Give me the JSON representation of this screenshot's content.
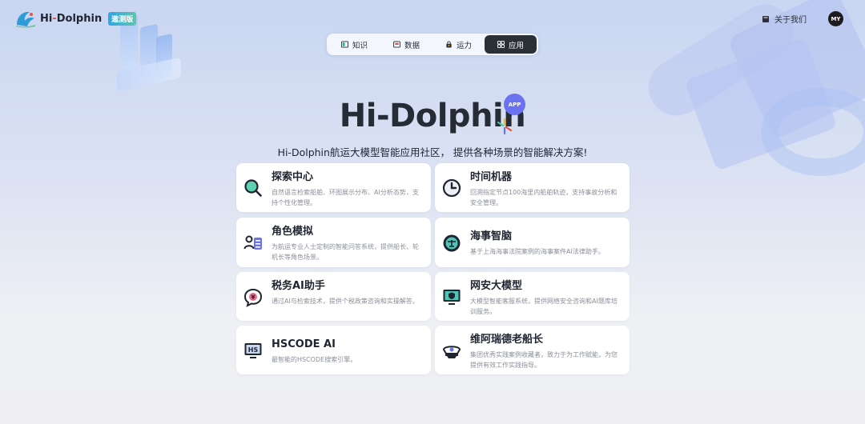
{
  "header": {
    "logo_prefix": "Hi",
    "logo_dash": "-",
    "logo_suffix": "Dolphin",
    "badge": "遨测版",
    "about_label": "关于我们",
    "avatar_initials": "MY"
  },
  "tabs": [
    {
      "label": "知识",
      "icon": "book-icon",
      "active": false
    },
    {
      "label": "数据",
      "icon": "database-icon",
      "active": false
    },
    {
      "label": "运力",
      "icon": "lock-icon",
      "active": false
    },
    {
      "label": "应用",
      "icon": "grid-icon",
      "active": true
    }
  ],
  "hero": {
    "title": "Hi-Dolphin",
    "app_badge": "APP",
    "subtitle": "Hi-Dolphin航运大模型智能应用社区， 提供各种场景的智能解决方案!"
  },
  "cards": [
    {
      "title": "探索中心",
      "desc": "自然语言检索船舶、环图展示分布、AI分析态势，支持个性化管理。",
      "icon": "search-icon"
    },
    {
      "title": "时间机器",
      "desc": "回溯指定节点100海里内船舶轨迹，支持事故分析和安全管理。",
      "icon": "clock-icon"
    },
    {
      "title": "角色模拟",
      "desc": "为航运专业人士定制的智能问答系统，提供船长、轮机长等角色场景。",
      "icon": "user-list-icon"
    },
    {
      "title": "海事智脑",
      "desc": "基于上海海事法院案例的海事案件AI法律助手。",
      "icon": "scales-icon"
    },
    {
      "title": "税务AI助手",
      "desc": "通过AI与检索技术，提供个税政策咨询和实操解答。",
      "icon": "tax-chat-icon"
    },
    {
      "title": "网安大模型",
      "desc": "大模型智能客服系统，提供网络安全咨询和AI题库培训服务。",
      "icon": "shield-monitor-icon"
    },
    {
      "title": "HSCODE AI",
      "desc": "最智能的HSCODE搜索引擎。",
      "icon": "hs-monitor-icon"
    },
    {
      "title": "维阿瑞德老船长",
      "desc": "集团优秀实践案例收藏者，致力于为工作赋能，为您提供有效工作实践指导。",
      "icon": "captain-hat-icon"
    }
  ],
  "colors": {
    "accent_dark": "#2b2f36",
    "app_badge": "#6a72f0",
    "logo_dash": "#e7543a"
  }
}
